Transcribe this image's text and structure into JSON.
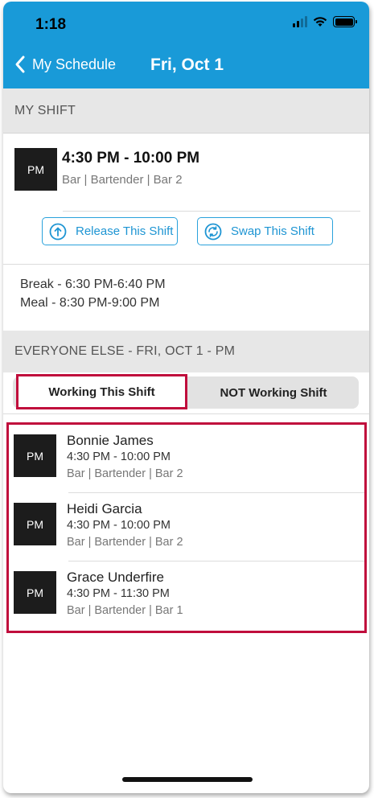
{
  "status": {
    "time": "1:18"
  },
  "nav": {
    "back_label": "My Schedule",
    "title": "Fri, Oct 1"
  },
  "my_shift": {
    "header": "MY SHIFT",
    "avatar": "PM",
    "time": "4:30 PM - 10:00 PM",
    "detail": "Bar | Bartender | Bar 2",
    "release_label": "Release This Shift",
    "swap_label": "Swap This Shift",
    "break_text": "Break - 6:30 PM-6:40 PM",
    "meal_text": "Meal - 8:30 PM-9:00 PM"
  },
  "everyone": {
    "header": "EVERYONE ELSE - FRI, OCT 1 - PM",
    "tabs": [
      {
        "label": "Working This Shift",
        "active": true
      },
      {
        "label": "NOT Working Shift",
        "active": false
      }
    ],
    "people": [
      {
        "avatar": "PM",
        "name": "Bonnie James",
        "time": "4:30 PM - 10:00 PM",
        "detail": "Bar | Bartender | Bar 2"
      },
      {
        "avatar": "PM",
        "name": "Heidi Garcia",
        "time": "4:30 PM - 10:00 PM",
        "detail": "Bar | Bartender | Bar 2"
      },
      {
        "avatar": "PM",
        "name": "Grace Underfire",
        "time": "4:30 PM - 11:30 PM",
        "detail": "Bar | Bartender | Bar 1"
      }
    ]
  },
  "colors": {
    "nav": "#199ad8",
    "accent": "#2aa2dc",
    "highlight": "#c00d3c"
  }
}
